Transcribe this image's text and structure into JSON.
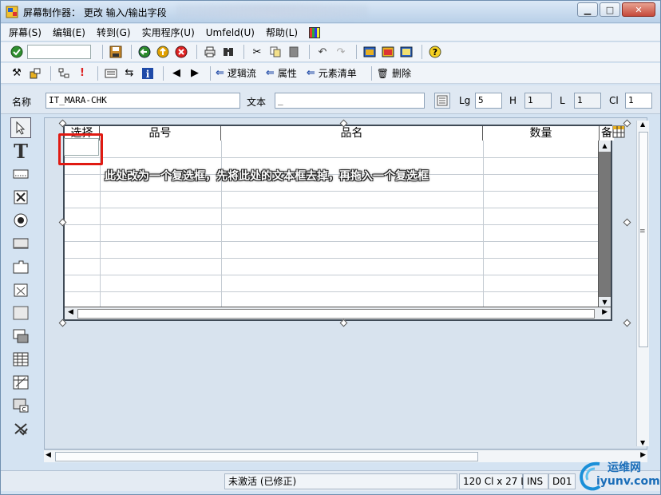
{
  "window": {
    "title": "屏幕制作器： 更改 输入/输出字段"
  },
  "menubar": {
    "items": [
      "屏幕(S)",
      "编辑(E)",
      "转到(G)",
      "实用程序(U)",
      "Umfeld(U)",
      "帮助(L)"
    ]
  },
  "toolbar2": {
    "logic_flow": "逻辑流",
    "attributes": "属性",
    "element_list": "元素清单",
    "delete": "删除"
  },
  "element_props": {
    "name_label": "名称",
    "name_value": "IT_MARA-CHK",
    "text_label": "文本",
    "text_value": "_",
    "lg_label": "Lg",
    "lg_value": "5",
    "h_label": "H",
    "h_value": "1",
    "l_label": "L",
    "l_value": "1",
    "cl_label": "Cl",
    "cl_value": "1"
  },
  "table": {
    "columns": [
      "选择",
      "品号",
      "品名",
      "数量",
      "备"
    ]
  },
  "annotation": "此处改为一个复选框，先将此处的文本框去掉，再拖入一个复选框",
  "status": {
    "state": "未激活 (已修正)",
    "size": "120 Cl x 27 L",
    "mode": "INS",
    "system": "D01"
  },
  "watermark": {
    "line1": "运维网",
    "line2": "iyunv.com"
  },
  "colors": {
    "highlight_red": "#e01a12",
    "arrow_blue": "#1f4aa8"
  }
}
